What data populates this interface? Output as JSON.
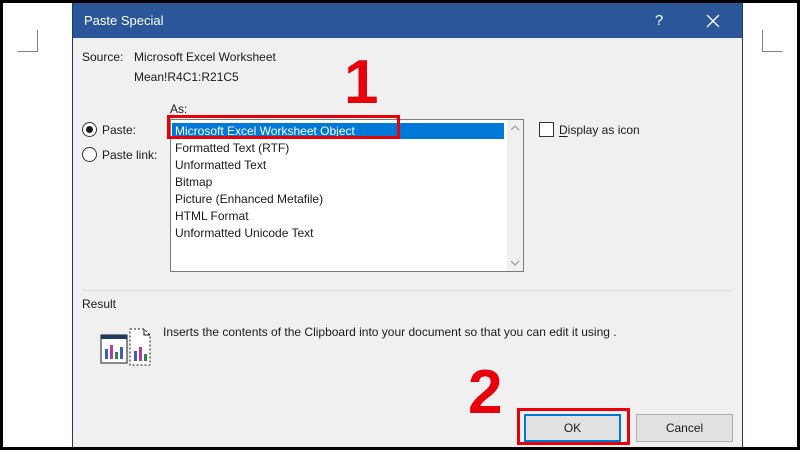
{
  "dialog": {
    "title": "Paste Special",
    "help_glyph": "?",
    "source_label": "Source:",
    "source_value": "Microsoft Excel Worksheet",
    "source_range": "Mean!R4C1:R21C5",
    "as_label": "As:",
    "paste_label": "Paste:",
    "paste_link_label": "Paste link:",
    "paste_checked": true,
    "display_as_icon_label": "Display as icon",
    "display_as_icon_checked": false,
    "as_list": [
      {
        "label": "Microsoft Excel Worksheet Object",
        "selected": true
      },
      {
        "label": "Formatted Text (RTF)",
        "selected": false
      },
      {
        "label": "Unformatted Text",
        "selected": false
      },
      {
        "label": "Bitmap",
        "selected": false
      },
      {
        "label": "Picture (Enhanced Metafile)",
        "selected": false
      },
      {
        "label": "HTML Format",
        "selected": false
      },
      {
        "label": "Unformatted Unicode Text",
        "selected": false
      }
    ],
    "result_label": "Result",
    "result_description": "Inserts the contents of the Clipboard into your document so that you can edit it using .",
    "ok_label": "OK",
    "cancel_label": "Cancel"
  },
  "annotations": {
    "step1": "1",
    "step2": "2",
    "color": "#e8000b"
  },
  "colors": {
    "titlebar": "#2b579a",
    "selection": "#0078d7",
    "dialog_bg": "#f0f0f0"
  }
}
